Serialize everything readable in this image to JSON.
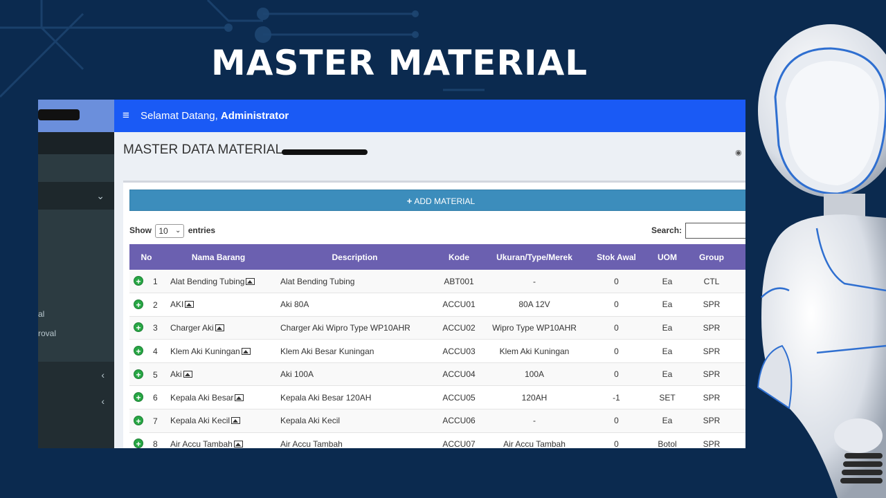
{
  "slide": {
    "title": "MASTER MATERIAL"
  },
  "topbar": {
    "greeting": "Selamat Datang,",
    "user": "Administrator"
  },
  "sidebar": {
    "partial_items": [
      "al",
      "roval"
    ]
  },
  "page": {
    "title": "MASTER DATA MATERIAL"
  },
  "actions": {
    "add_label": "ADD MATERIAL"
  },
  "table_controls": {
    "show_label": "Show",
    "entries_value": "10",
    "entries_label": "entries",
    "search_label": "Search:"
  },
  "table": {
    "headers": [
      "No",
      "Nama Barang",
      "Description",
      "Kode",
      "Ukuran/Type/Merek",
      "Stok Awal",
      "UOM",
      "Group"
    ],
    "rows": [
      {
        "no": "1",
        "nama": "Alat Bending Tubing",
        "desc": "Alat Bending Tubing",
        "kode": "ABT001",
        "ukuran": "-",
        "stok": "0",
        "uom": "Ea",
        "group": "CTL"
      },
      {
        "no": "2",
        "nama": "AKI",
        "desc": "Aki 80A",
        "kode": "ACCU01",
        "ukuran": "80A 12V",
        "stok": "0",
        "uom": "Ea",
        "group": "SPR"
      },
      {
        "no": "3",
        "nama": "Charger Aki",
        "desc": "Charger Aki Wipro Type WP10AHR",
        "kode": "ACCU02",
        "ukuran": "Wipro Type WP10AHR",
        "stok": "0",
        "uom": "Ea",
        "group": "SPR"
      },
      {
        "no": "4",
        "nama": "Klem Aki Kuningan",
        "desc": "Klem Aki Besar Kuningan",
        "kode": "ACCU03",
        "ukuran": "Klem Aki Kuningan",
        "stok": "0",
        "uom": "Ea",
        "group": "SPR"
      },
      {
        "no": "5",
        "nama": "Aki",
        "desc": "Aki 100A",
        "kode": "ACCU04",
        "ukuran": "100A",
        "stok": "0",
        "uom": "Ea",
        "group": "SPR"
      },
      {
        "no": "6",
        "nama": "Kepala Aki Besar",
        "desc": "Kepala Aki Besar 120AH",
        "kode": "ACCU05",
        "ukuran": "120AH",
        "stok": "-1",
        "uom": "SET",
        "group": "SPR"
      },
      {
        "no": "7",
        "nama": "Kepala Aki Kecil",
        "desc": "Kepala Aki Kecil",
        "kode": "ACCU06",
        "ukuran": "-",
        "stok": "0",
        "uom": "Ea",
        "group": "SPR"
      },
      {
        "no": "8",
        "nama": "Air Accu Tambah",
        "desc": "Air Accu Tambah",
        "kode": "ACCU07",
        "ukuran": "Air Accu Tambah",
        "stok": "0",
        "uom": "Botol",
        "group": "SPR"
      }
    ]
  },
  "colors": {
    "background": "#0b2a4f",
    "topbar": "#1a5af5",
    "table_header": "#6b60b0",
    "add_button": "#3c8dbc",
    "expand_icon": "#28a745",
    "sidebar": "#222d32"
  },
  "icons": {
    "menu": "hamburger-icon",
    "expand": "plus-circle-icon",
    "image": "image-icon",
    "dashboard": "dashboard-icon"
  }
}
